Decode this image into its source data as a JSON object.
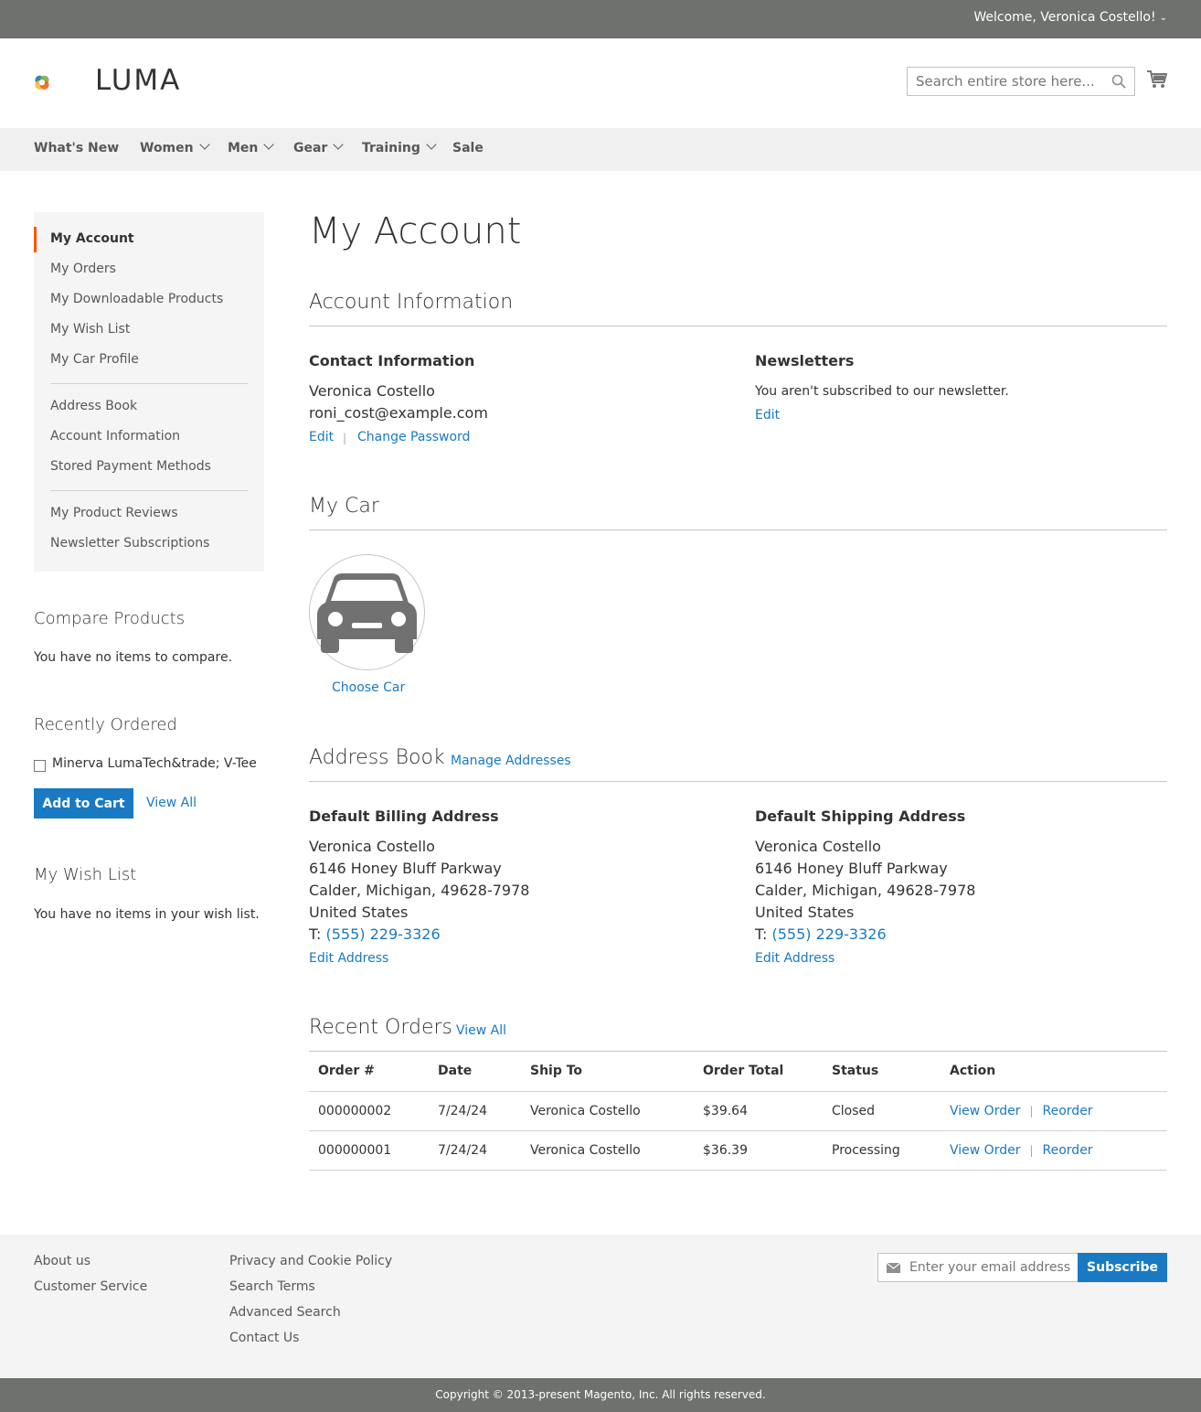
{
  "header": {
    "welcome": "Welcome, Veronica Costello!",
    "logo_text": "LUMA",
    "search_placeholder": "Search entire store here...",
    "nav": [
      "What's New",
      "Women",
      "Men",
      "Gear",
      "Training",
      "Sale"
    ]
  },
  "sidebar": {
    "account_nav": [
      "My Account",
      "My Orders",
      "My Downloadable Products",
      "My Wish List",
      "My Car Profile",
      "Address Book",
      "Account Information",
      "Stored Payment Methods",
      "My Product Reviews",
      "Newsletter Subscriptions"
    ],
    "compare": {
      "title": "Compare Products",
      "empty": "You have no items to compare."
    },
    "recently_ordered": {
      "title": "Recently Ordered",
      "item": "Minerva LumaTech&trade; V-Tee",
      "add_to_cart": "Add to Cart",
      "view_all": "View All"
    },
    "wishlist": {
      "title": "My Wish List",
      "empty": "You have no items in your wish list."
    }
  },
  "main": {
    "page_title": "My Account",
    "account_info": {
      "title": "Account Information",
      "contact_title": "Contact Information",
      "name": "Veronica Costello",
      "email": "roni_cost@example.com",
      "edit": "Edit",
      "change_password": "Change Password",
      "newsletters_title": "Newsletters",
      "newsletters_text": "You aren't subscribed to our newsletter.",
      "newsletters_edit": "Edit"
    },
    "my_car": {
      "title": "My Car",
      "choose_car": "Choose Car"
    },
    "address_book": {
      "title": "Address Book",
      "manage": "Manage Addresses",
      "billing": {
        "title": "Default Billing Address",
        "name": "Veronica Costello",
        "street": "6146 Honey Bluff Parkway",
        "city": "Calder, Michigan, 49628-7978",
        "country": "United States",
        "tel_prefix": "T: ",
        "phone": "(555) 229-3326",
        "edit": "Edit Address"
      },
      "shipping": {
        "title": "Default Shipping Address",
        "name": "Veronica Costello",
        "street": "6146 Honey Bluff Parkway",
        "city": "Calder, Michigan, 49628-7978",
        "country": "United States",
        "tel_prefix": "T: ",
        "phone": "(555) 229-3326",
        "edit": "Edit Address"
      }
    },
    "recent_orders": {
      "title": "Recent Orders",
      "view_all": "View All",
      "columns": [
        "Order #",
        "Date",
        "Ship To",
        "Order Total",
        "Status",
        "Action"
      ],
      "rows": [
        {
          "order": "000000002",
          "date": "7/24/24",
          "ship_to": "Veronica Costello",
          "total": "$39.64",
          "status": "Closed",
          "view": "View Order",
          "reorder": "Reorder"
        },
        {
          "order": "000000001",
          "date": "7/24/24",
          "ship_to": "Veronica Costello",
          "total": "$36.39",
          "status": "Processing",
          "view": "View Order",
          "reorder": "Reorder"
        }
      ]
    }
  },
  "footer": {
    "col1": [
      "About us",
      "Customer Service"
    ],
    "col2": [
      "Privacy and Cookie Policy",
      "Search Terms",
      "Advanced Search",
      "Contact Us"
    ],
    "newsletter_placeholder": "Enter your email address",
    "subscribe": "Subscribe",
    "copyright": "Copyright © 2013-present Magento, Inc. All rights reserved."
  },
  "colors": {
    "accent": "#1979c3",
    "active_marker": "#ff5501",
    "topbar": "#6e716e"
  },
  "icons": [
    "luma-logo-icon",
    "search-icon",
    "cart-icon",
    "chevron-down-icon",
    "car-icon",
    "mail-icon"
  ]
}
